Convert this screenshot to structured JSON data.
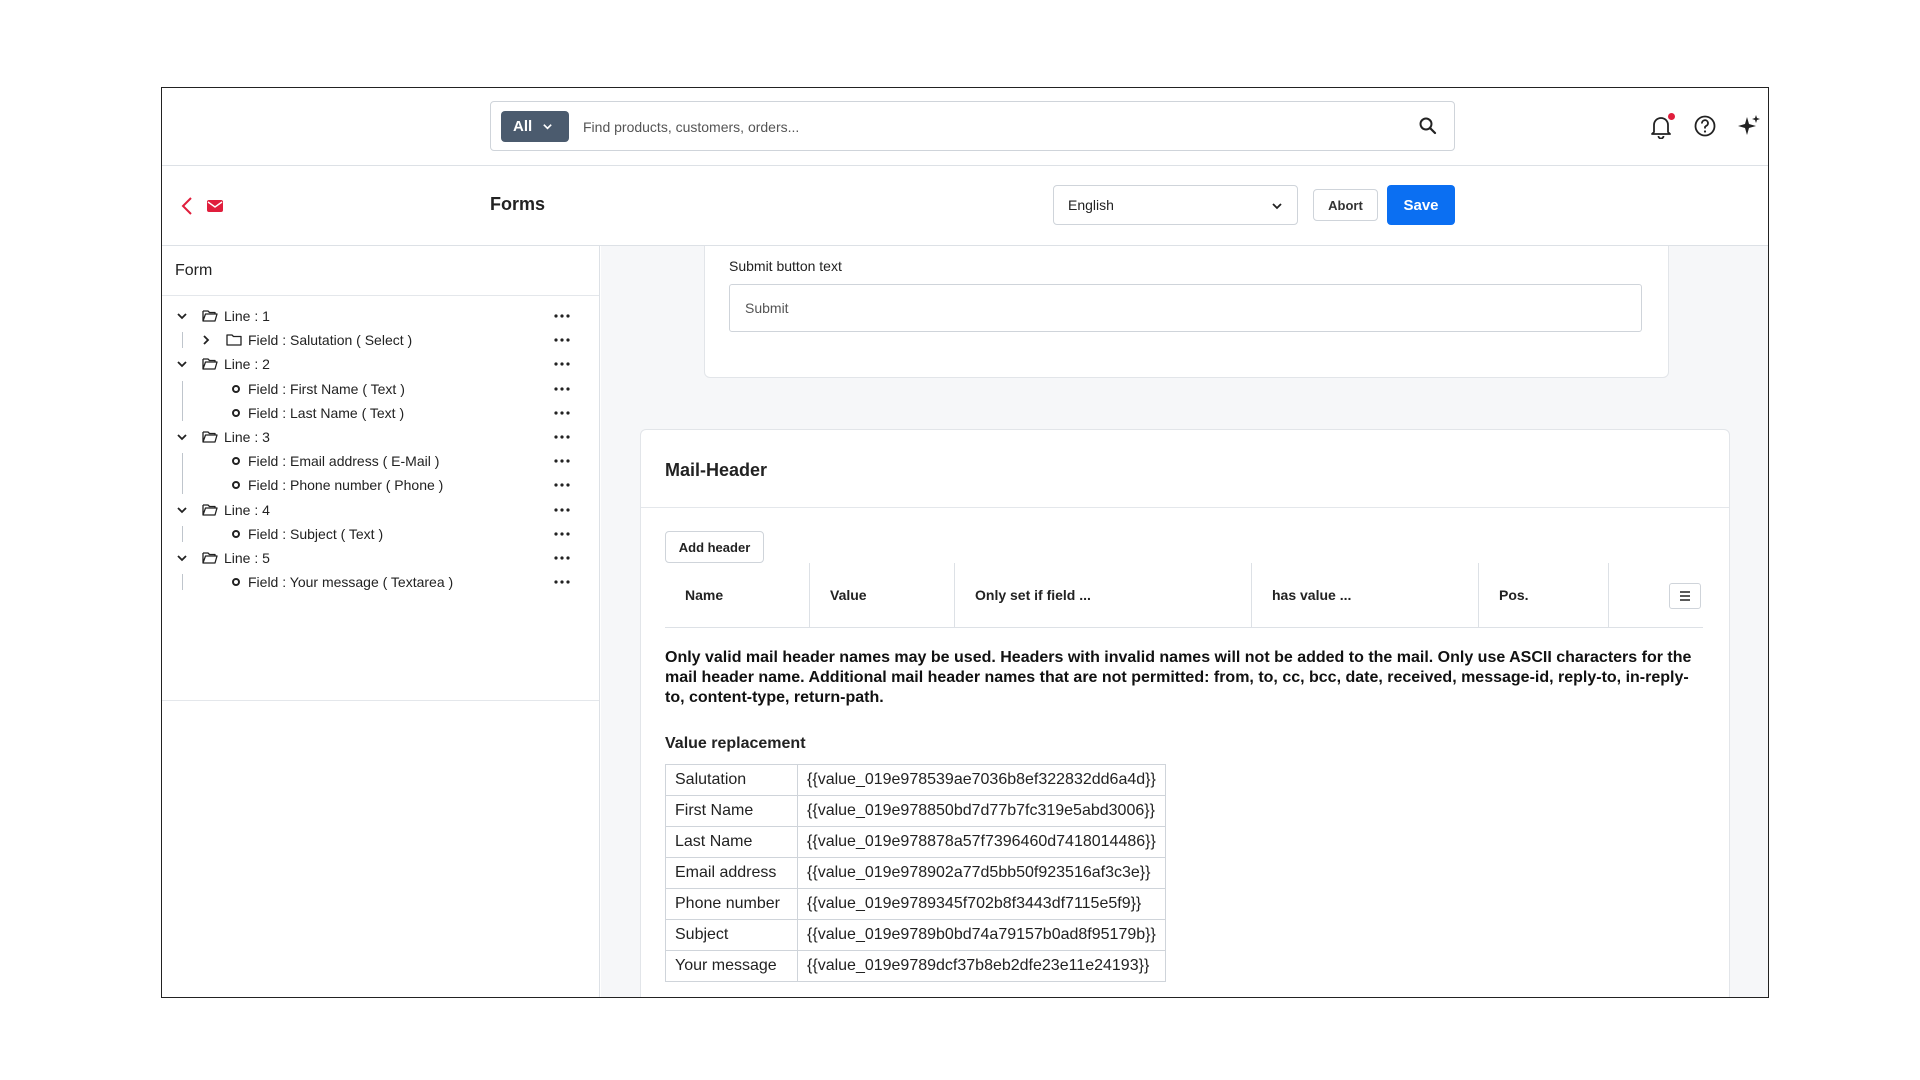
{
  "search": {
    "scope_label": "All",
    "placeholder": "Find products, customers, orders..."
  },
  "header": {
    "title": "Forms",
    "language": "English",
    "abort_label": "Abort",
    "save_label": "Save"
  },
  "tree": {
    "title": "Form",
    "nodes": [
      {
        "label": "Line : 1",
        "kind": "line",
        "expanded": true
      },
      {
        "label": "Field : Salutation ( Select )",
        "kind": "folder-field",
        "expanded": false
      },
      {
        "label": "Line : 2",
        "kind": "line",
        "expanded": true
      },
      {
        "label": "Field : First Name ( Text )",
        "kind": "field"
      },
      {
        "label": "Field : Last Name ( Text )",
        "kind": "field"
      },
      {
        "label": "Line : 3",
        "kind": "line",
        "expanded": true
      },
      {
        "label": "Field : Email address ( E-Mail )",
        "kind": "field"
      },
      {
        "label": "Field : Phone number ( Phone )",
        "kind": "field"
      },
      {
        "label": "Line : 4",
        "kind": "line",
        "expanded": true
      },
      {
        "label": "Field : Subject ( Text )",
        "kind": "field"
      },
      {
        "label": "Line : 5",
        "kind": "line",
        "expanded": true
      },
      {
        "label": "Field : Your message ( Textarea )",
        "kind": "field"
      }
    ]
  },
  "submit": {
    "label": "Submit button text",
    "value": "Submit"
  },
  "mail_header": {
    "title": "Mail-Header",
    "add_label": "Add header",
    "columns": [
      "Name",
      "Value",
      "Only set if field ...",
      "has value ...",
      "Pos."
    ],
    "notice": "Only valid mail header names may be used. Headers with invalid names will not be added to the mail. Only use ASCII characters for the mail header name. Additional mail header names that are not permitted: from, to, cc, bcc, date, received, message-id, reply-to, in-reply-to, content-type, return-path.",
    "replacement_title": "Value replacement",
    "replacements": [
      {
        "name": "Salutation",
        "value": "{{value_019e978539ae7036b8ef322832dd6a4d}}"
      },
      {
        "name": "First Name",
        "value": "{{value_019e978850bd7d77b7fc319e5abd3006}}"
      },
      {
        "name": "Last Name",
        "value": "{{value_019e978878a57f7396460d7418014486}}"
      },
      {
        "name": "Email address",
        "value": "{{value_019e978902a77d5bb50f923516af3c3e}}"
      },
      {
        "name": "Phone number",
        "value": "{{value_019e9789345f702b8f3443df7115e5f9}}"
      },
      {
        "name": "Subject",
        "value": "{{value_019e9789b0bd74a79157b0ad8f95179b}}"
      },
      {
        "name": "Your message",
        "value": "{{value_019e9789dcf37b8eb2dfe23e11e24193}}"
      }
    ]
  },
  "colors": {
    "primary": "#0b6ff2",
    "scope_bg": "#4b5b6e",
    "accent_red": "#e01e3c"
  }
}
